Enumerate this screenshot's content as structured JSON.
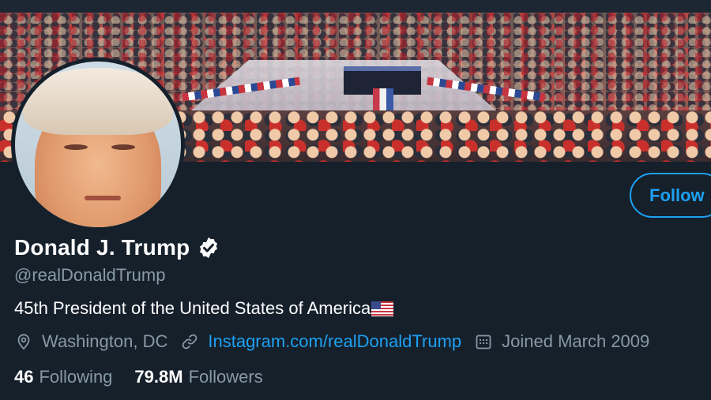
{
  "profile": {
    "name": "Donald J. Trump",
    "verified_icon": "verified-badge-icon",
    "handle": "@realDonaldTrump",
    "bio": "45th President of the United States of America",
    "bio_emoji": "us-flag-emoji",
    "location": "Washington, DC",
    "website": "Instagram.com/realDonaldTrump",
    "joined": "Joined March 2009"
  },
  "actions": {
    "follow_label": "Follow"
  },
  "stats": {
    "following_count": "46",
    "following_label": "Following",
    "followers_count": "79.8M",
    "followers_label": "Followers"
  },
  "icons": {
    "location": "location-pin-icon",
    "website": "link-icon",
    "joined": "calendar-icon"
  },
  "colors": {
    "background": "#15202b",
    "accent": "#1da1f2",
    "secondary_text": "#8899a6",
    "primary_text": "#ffffff"
  }
}
